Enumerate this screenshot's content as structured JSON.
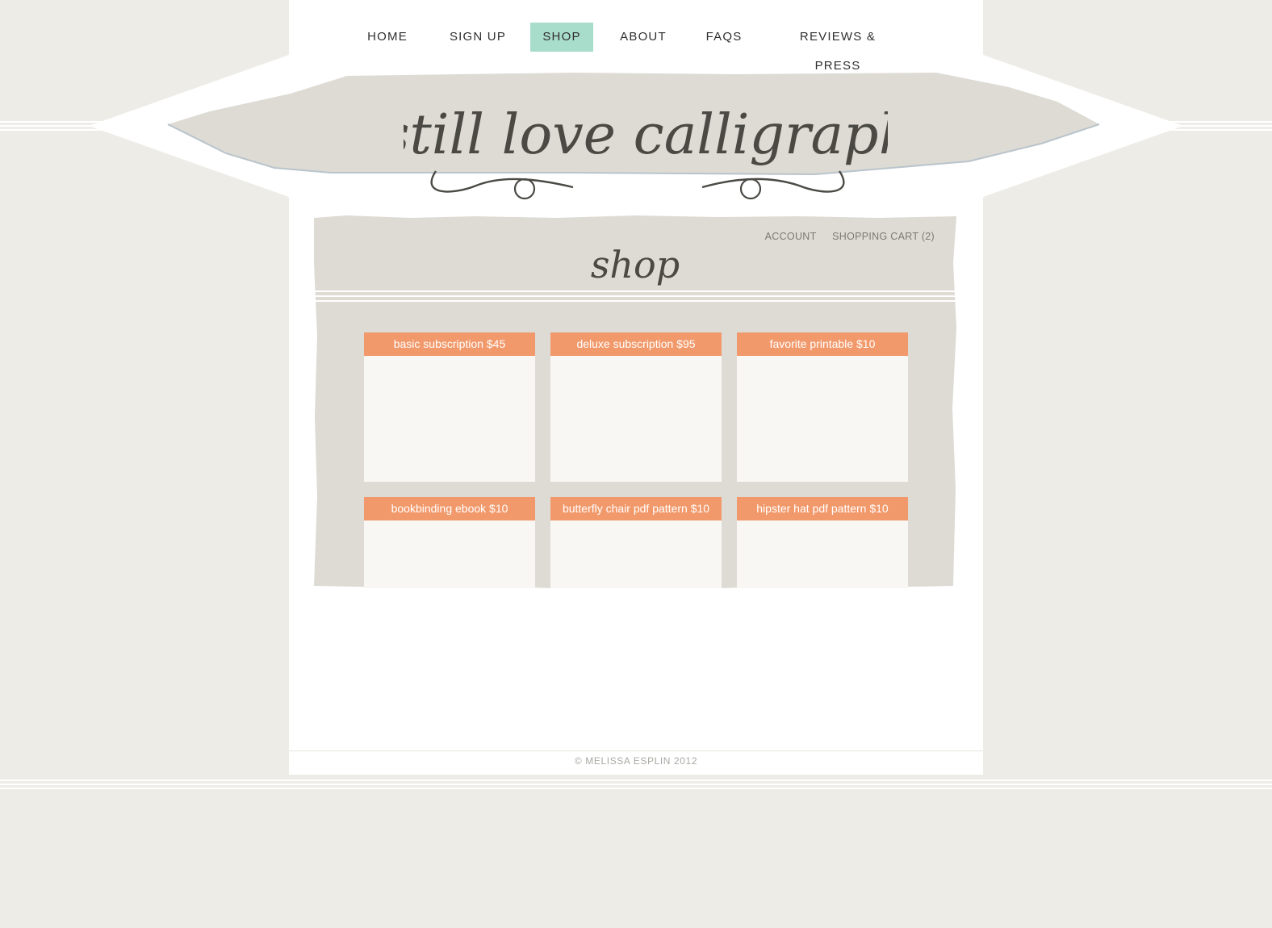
{
  "nav": {
    "items": [
      {
        "label": "HOME",
        "active": false
      },
      {
        "label": "SIGN UP",
        "active": false
      },
      {
        "label": "SHOP",
        "active": true
      },
      {
        "label": "ABOUT",
        "active": false
      },
      {
        "label": "FAQS",
        "active": false
      },
      {
        "label": "REVIEWS & PRESS",
        "active": false
      }
    ]
  },
  "logo": {
    "text": "i still love calligraphy"
  },
  "shop": {
    "title": "shop",
    "account_label": "ACCOUNT",
    "cart_label": "SHOPPING CART (2)",
    "products": [
      {
        "label": "basic subscription $45"
      },
      {
        "label": "deluxe subscription $95"
      },
      {
        "label": "favorite printable $10"
      },
      {
        "label": "bookbinding ebook $10"
      },
      {
        "label": "butterfly chair pdf pattern $10"
      },
      {
        "label": "hipster hat pdf pattern $10"
      }
    ]
  },
  "footer": {
    "copyright": "© MELISSA ESPLIN 2012"
  },
  "colors": {
    "page_bg": "#edece7",
    "nav_active": "#a8dccb",
    "product_label": "#f2996b",
    "paper": "#dddbd4"
  }
}
